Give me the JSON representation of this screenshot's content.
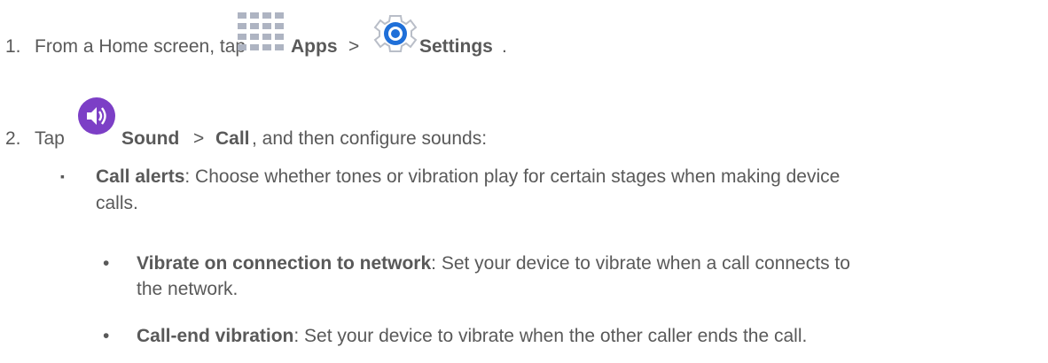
{
  "step1": {
    "number": "1.",
    "prefix": "From a Home screen, tap",
    "apps_label": "Apps",
    "sep": ">",
    "settings_label": "Settings",
    "suffix": ".",
    "apps_icon": "apps-grid-icon",
    "settings_icon": "settings-gear-icon"
  },
  "step2": {
    "number": "2.",
    "prefix": "Tap",
    "sound_label": "Sound",
    "sep": ">",
    "call_label": "Call",
    "suffix": ", and then configure sounds:",
    "sound_icon": "sound-speaker-icon"
  },
  "call_alerts": {
    "bullet": "▪",
    "title": "Call alerts",
    "desc_line1": ": Choose whether tones or vibration play for certain stages when making device",
    "desc_line2": "calls."
  },
  "sub_items": [
    {
      "bullet": "•",
      "title": "Vibrate on connection to network",
      "desc_line1": ": Set your device to vibrate when a call connects to",
      "desc_line2": "the network."
    },
    {
      "bullet": "•",
      "title": "Call-end vibration",
      "desc_line1": ": Set your device to vibrate when the other caller ends the call.",
      "desc_line2": ""
    }
  ],
  "colors": {
    "text": "#595959",
    "apps_grid": "#aeb4c2",
    "settings_blue": "#1f6fd8",
    "sound_purple": "#7c3fc6"
  }
}
